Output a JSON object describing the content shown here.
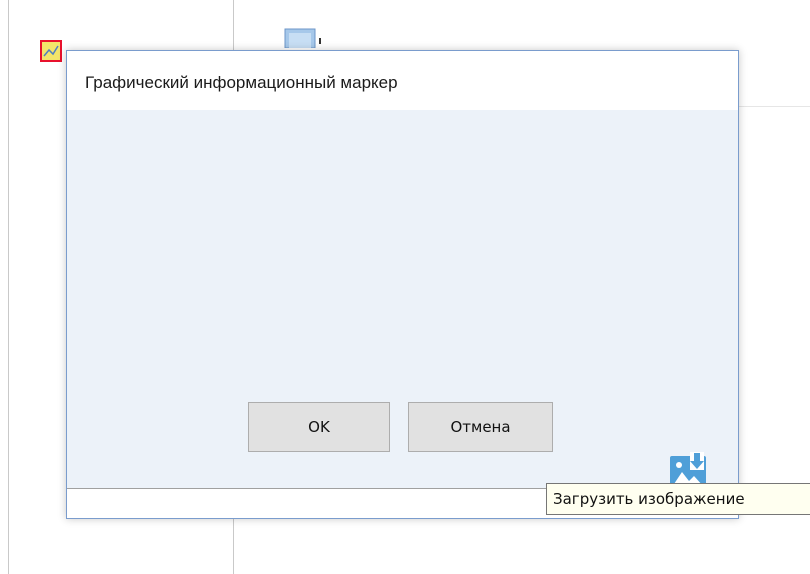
{
  "dialog": {
    "title": "Графический информационный маркер",
    "ok_label": "OK",
    "cancel_label": "Отмена",
    "upload_icon": "image-download-icon"
  },
  "tooltip": {
    "text": "Загрузить изображение"
  },
  "background": {
    "marker_icon": "image-marker-icon",
    "marker_icon_border_color": "#e8112d",
    "marker_icon_fill_color": "#f3e56a"
  },
  "colors": {
    "dialog_border": "#7a9ccd",
    "dialog_body": "#ecf2f9",
    "button_face": "#e1e1e1",
    "tooltip_bg": "#fffff0",
    "icon_blue": "#4f9fd8"
  }
}
